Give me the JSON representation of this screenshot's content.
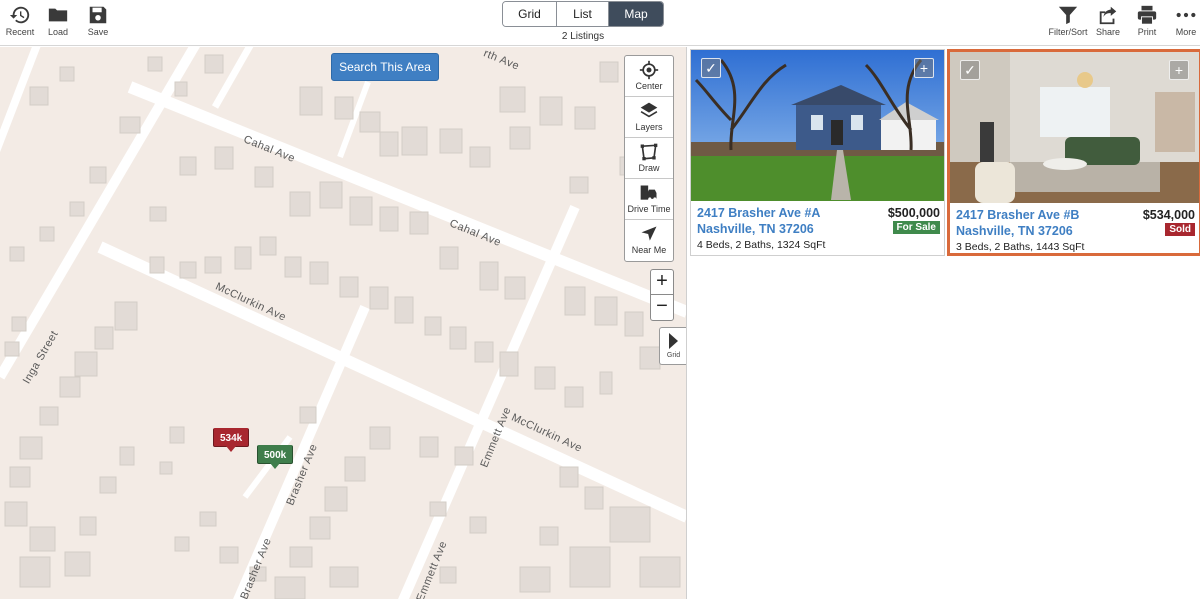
{
  "toolbar": {
    "left_tools": [
      {
        "label": "Recent",
        "icon": "history-icon"
      },
      {
        "label": "Load",
        "icon": "folder-icon"
      },
      {
        "label": "Save",
        "icon": "save-icon"
      }
    ],
    "right_tools": [
      {
        "label": "Filter/Sort",
        "icon": "filter-icon"
      },
      {
        "label": "Share",
        "icon": "share-icon"
      },
      {
        "label": "Print",
        "icon": "print-icon"
      },
      {
        "label": "More",
        "icon": "more-icon"
      }
    ],
    "view_tabs": [
      {
        "label": "Grid",
        "active": false
      },
      {
        "label": "List",
        "active": false
      },
      {
        "label": "Map",
        "active": true
      }
    ],
    "listing_count": "2 Listings"
  },
  "map": {
    "search_button": "Search This Area",
    "controls": [
      {
        "label": "Center",
        "icon": "crosshair-icon"
      },
      {
        "label": "Layers",
        "icon": "layers-icon"
      },
      {
        "label": "Draw",
        "icon": "draw-icon"
      },
      {
        "label": "Drive Time",
        "icon": "drive-time-icon"
      },
      {
        "label": "Near Me",
        "icon": "near-me-icon"
      }
    ],
    "zoom_in": "+",
    "zoom_out": "−",
    "panel_toggle_label": "Grid",
    "street_labels": [
      "Cahal Ave",
      "Cahal Ave",
      "McClurkin Ave",
      "McClurkin Ave",
      "Inga Street",
      "Emmett Ave",
      "Brasher Ave",
      "Brasher Ave",
      "Emmett Ave",
      "rth Ave"
    ],
    "pins": [
      {
        "label": "534k",
        "status": "sold"
      },
      {
        "label": "500k",
        "status": "for-sale"
      }
    ]
  },
  "listings": [
    {
      "address_line1": "2417 Brasher Ave #A",
      "address_line2": "Nashville, TN 37206",
      "price": "$500,000",
      "status": "For Sale",
      "details": "4 Beds, 2 Baths, 1324 SqFt",
      "selected": false,
      "checkbox_glyph": "✓",
      "add_glyph": "+"
    },
    {
      "address_line1": "2417 Brasher Ave #B",
      "address_line2": "Nashville, TN 37206",
      "price": "$534,000",
      "status": "Sold",
      "details": "3 Beds, 2 Baths, 1443 SqFt",
      "selected": true,
      "checkbox_glyph": "✓",
      "add_glyph": "+"
    }
  ],
  "colors": {
    "accent_blue": "#3f7fc3",
    "active_tab": "#3f4c5c",
    "sold_red": "#a8272f",
    "for_sale_green": "#3f8a4c",
    "selected_border": "#d96a3b",
    "map_background": "#f3ebe5"
  }
}
